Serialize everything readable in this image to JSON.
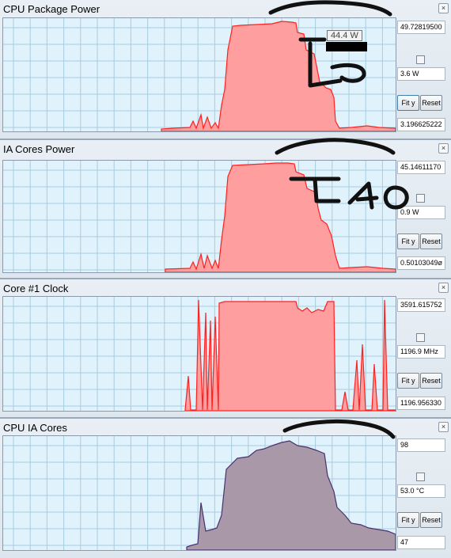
{
  "panels": [
    {
      "title": "CPU Package Power",
      "close": "",
      "max": "49.72819500",
      "unit": "3.6 W",
      "min": "3.196625222",
      "fit": "Fit y",
      "reset": "Reset",
      "fill": "#ff9e9e",
      "stroke": "#ff2020"
    },
    {
      "title": "IA Cores Power",
      "close": "×",
      "max": "45.14611170",
      "unit": "0.9 W",
      "min": "0.50103049ø",
      "fit": "Fit y",
      "reset": "Reset",
      "fill": "#ff9e9e",
      "stroke": "#ff2020"
    },
    {
      "title": "Core #1 Clock",
      "close": "×",
      "max": "3591.615752",
      "unit": "1196.9 MHz",
      "min": "1196.956330",
      "fit": "Fit y",
      "reset": "Reset",
      "fill": "#ff9e9e",
      "stroke": "#ff2020"
    },
    {
      "title": "CPU IA Cores",
      "close": "×",
      "max": "98",
      "unit": "53.0 °C",
      "min": "47",
      "fit": "Fit y",
      "reset": "Reset",
      "fill": "#a898a8",
      "stroke": "#4a3070"
    }
  ],
  "tooltip": "44.4 W"
}
